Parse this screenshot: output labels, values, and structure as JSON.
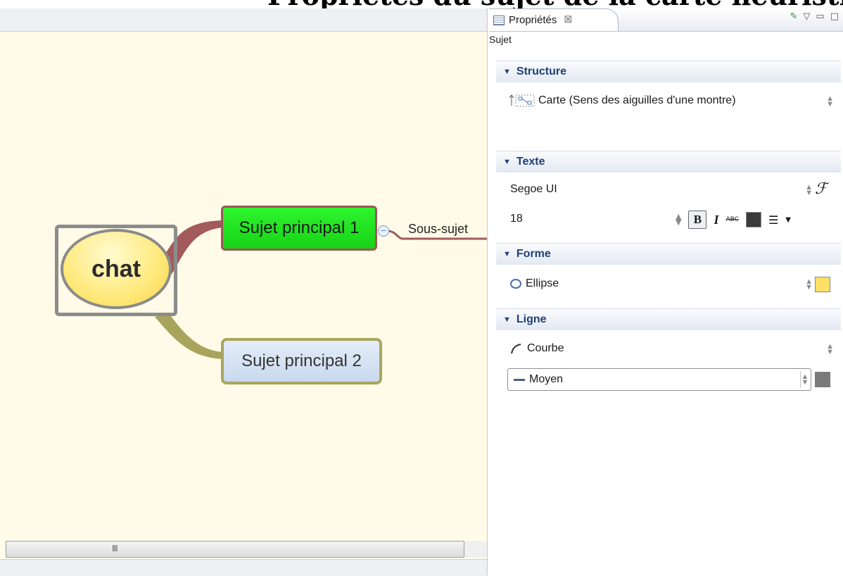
{
  "page_title": "Propriétés du sujet de la carte heuristique",
  "editor": {
    "hscroll_grip": "III"
  },
  "map": {
    "central": "chat",
    "topics": [
      {
        "label": "Sujet principal 1",
        "color": "#22e022"
      },
      {
        "label": "Sujet principal  2",
        "color": "#d6e3f4"
      }
    ],
    "collapse_symbol": "−",
    "subtopic": "Sous-sujet"
  },
  "properties": {
    "tab_label": "Propriétés",
    "tab_close": "☒",
    "subject": "Sujet",
    "sections": {
      "structure": {
        "title": "Structure",
        "value": "Carte (Sens des aiguilles d'une montre)"
      },
      "text": {
        "title": "Texte",
        "font": "Segoe UI",
        "size": "18",
        "bold": "B",
        "italic": "I",
        "strike": "ABC",
        "text_color": "#3a3a3a",
        "font_button": "ℱ"
      },
      "shape": {
        "title": "Forme",
        "value": "Ellipse",
        "fill_color": "#ffe066"
      },
      "line": {
        "title": "Ligne",
        "shape_value": "Courbe",
        "width_value": "Moyen",
        "color": "#7a7a7a"
      }
    }
  }
}
